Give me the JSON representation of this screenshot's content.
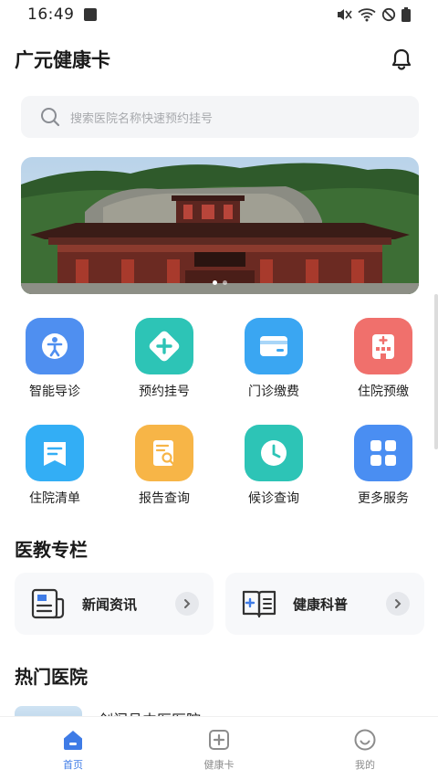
{
  "status_bar": {
    "time": "16:49"
  },
  "header": {
    "title": "广元健康卡"
  },
  "search": {
    "placeholder": "搜索医院名称快速预约挂号"
  },
  "services": [
    {
      "label": "智能导诊",
      "icon": "person-guide-icon",
      "color": "#4f8ff0"
    },
    {
      "label": "预约挂号",
      "icon": "plus-cross-icon",
      "color": "#2dc4b6"
    },
    {
      "label": "门诊缴费",
      "icon": "card-icon",
      "color": "#3aa6f2"
    },
    {
      "label": "住院预缴",
      "icon": "hospital-icon",
      "color": "#f0706c"
    },
    {
      "label": "住院清单",
      "icon": "list-doc-icon",
      "color": "#33aef5"
    },
    {
      "label": "报告查询",
      "icon": "report-search-icon",
      "color": "#f7b547"
    },
    {
      "label": "候诊查询",
      "icon": "clock-icon",
      "color": "#2dc4b6"
    },
    {
      "label": "更多服务",
      "icon": "apps-grid-icon",
      "color": "#4a8ef2"
    }
  ],
  "edu_section": {
    "title": "医教专栏",
    "cards": [
      {
        "label": "新闻资讯",
        "icon": "newspaper-icon"
      },
      {
        "label": "健康科普",
        "icon": "book-icon"
      }
    ]
  },
  "hospitals_section": {
    "title": "热门医院",
    "first_item": "剑阁县中医医院"
  },
  "tabbar": {
    "tabs": [
      {
        "label": "首页",
        "icon": "home-icon",
        "active": true
      },
      {
        "label": "健康卡",
        "icon": "health-card-icon",
        "active": false
      },
      {
        "label": "我的",
        "icon": "smile-icon",
        "active": false
      }
    ]
  },
  "colors": {
    "accent": "#3e7be6",
    "inactive": "#8c8c8c"
  }
}
